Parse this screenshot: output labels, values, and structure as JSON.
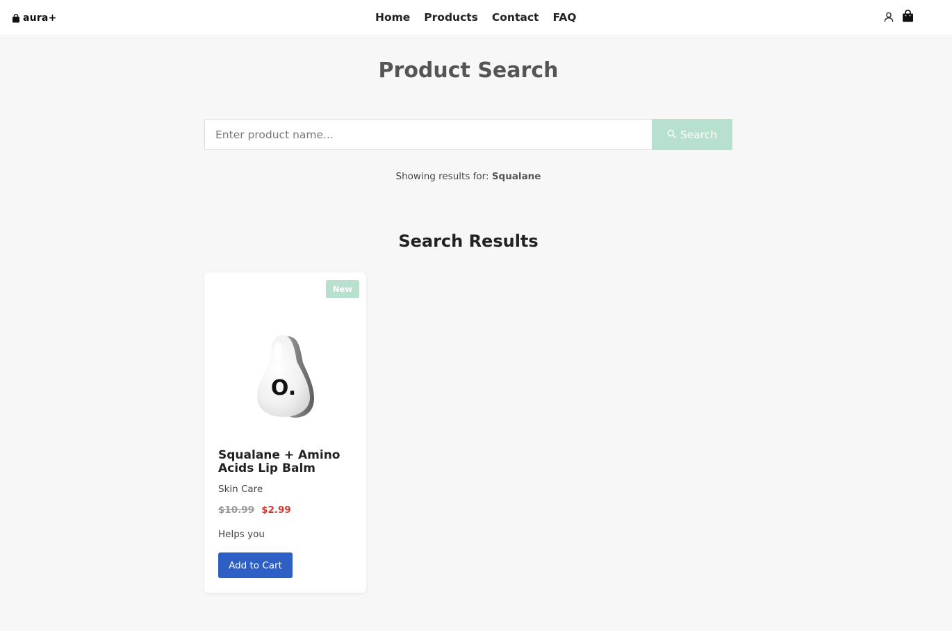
{
  "header": {
    "logo_text": "aura+",
    "nav": [
      {
        "label": "Home"
      },
      {
        "label": "Products"
      },
      {
        "label": "Contact"
      },
      {
        "label": "FAQ"
      }
    ],
    "icons": [
      "user-icon",
      "shopping-bag-icon"
    ]
  },
  "main": {
    "title": "Product Search",
    "search": {
      "placeholder": "Enter product name...",
      "value": "",
      "button_label": "Search",
      "button_icon": "search-icon"
    },
    "results_prefix": "Showing results for:",
    "results_query": "Squalane",
    "results_title": "Search Results"
  },
  "products": [
    {
      "badge": "New",
      "name": "Squalane + Amino Acids Lip Balm",
      "category": "Skin Care",
      "original_price": "$10.99",
      "sale_price": "$2.99",
      "description": "Helps you",
      "button_label": "Add to Cart",
      "image_label": "O."
    }
  ],
  "colors": {
    "accent_mint": "#b7e0cf",
    "button_blue": "#2d5fc4",
    "sale_red": "#d63a2f",
    "background": "#f7f7f7"
  }
}
